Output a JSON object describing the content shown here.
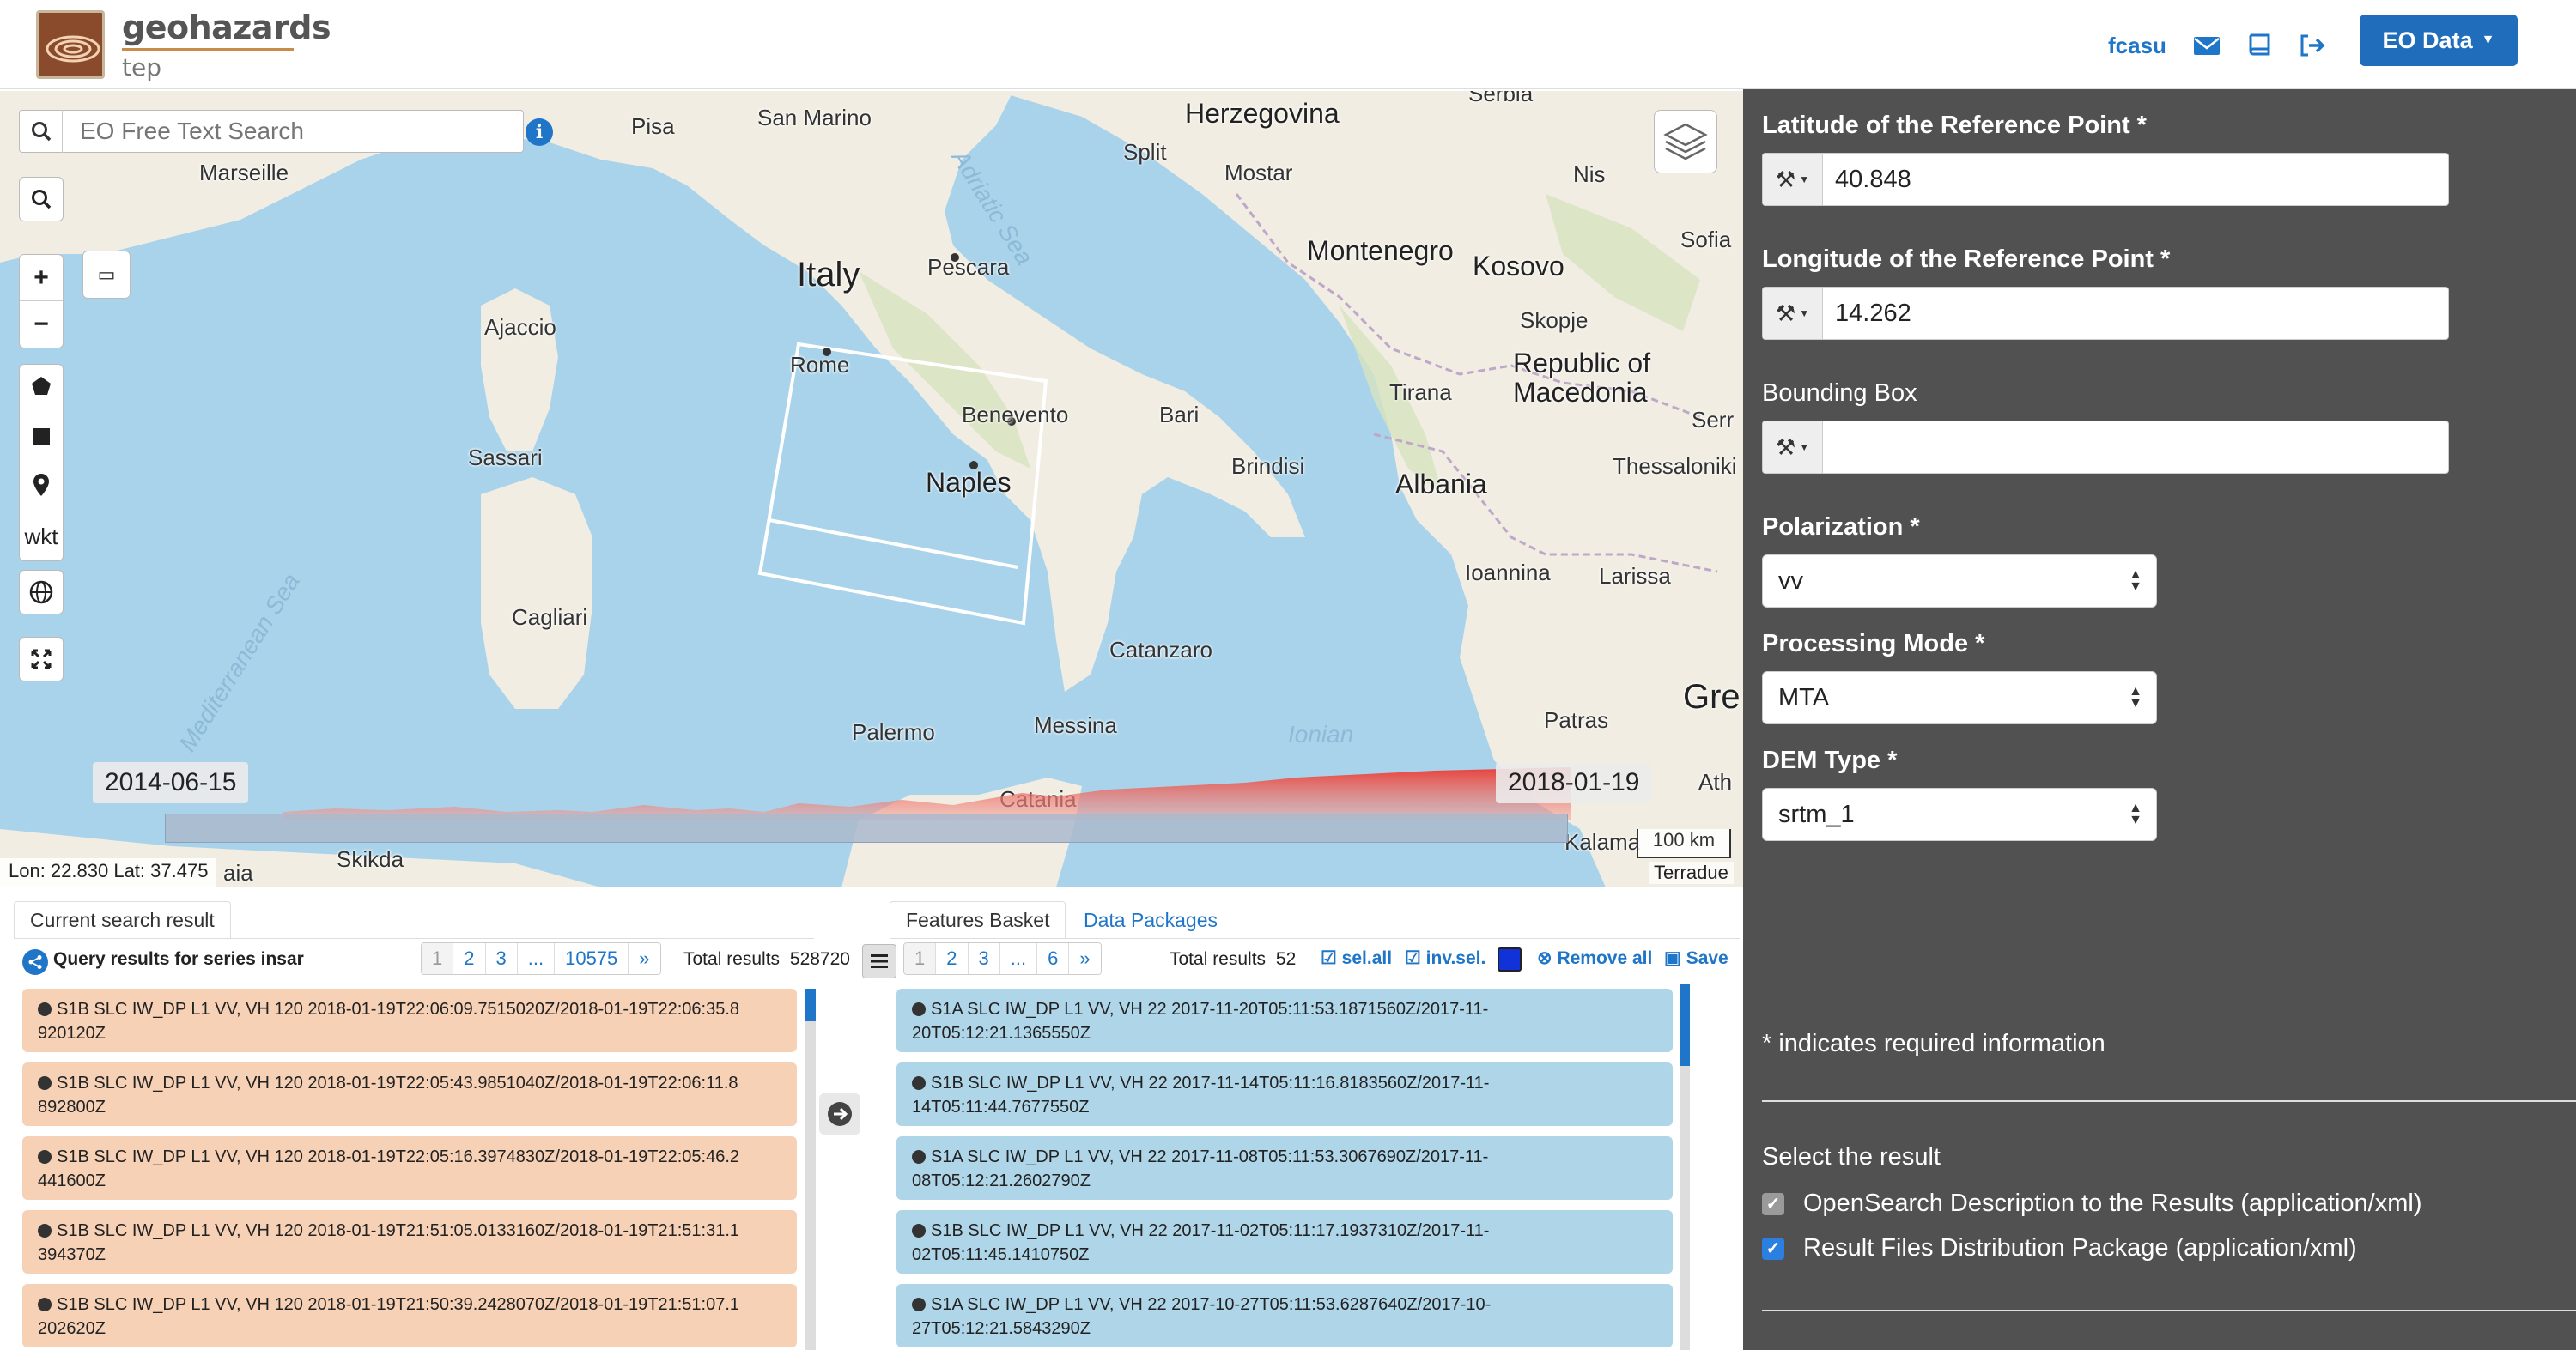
{
  "header": {
    "brand_name": "geohazards",
    "brand_sub": "tep",
    "user": "fcasu",
    "eo_data_label": "EO Data"
  },
  "map": {
    "search_placeholder": "EO Free Text Search",
    "ruler_glyph": "▭",
    "wkt_label": "wkt",
    "coords": "Lon: 22.830 Lat: 37.475",
    "scale": "100 km",
    "attribution": "Terradue",
    "timeline_start": "2014-06-15",
    "timeline_end": "2018-01-19",
    "places": {
      "herzegovina": "Herzegovina",
      "italy": "Italy",
      "albania": "Albania",
      "san_marino": "San Marino",
      "pisa": "Pisa",
      "marseille": "Marseille",
      "ajaccio": "Ajaccio",
      "sassari": "Sassari",
      "cagliari": "Cagliari",
      "rome": "Rome",
      "naples": "Naples",
      "benevento": "Benevento",
      "pescara": "Pescara",
      "split": "Split",
      "mostar": "Mostar",
      "nis": "Nis",
      "montenegro": "Montenegro",
      "kosovo": "Kosovo",
      "sofia": "Sofia",
      "skopje": "Skopje",
      "republic_of_macedonia": "Republic of\nMacedonia",
      "tirana": "Tirana",
      "bari": "Bari",
      "brindisi": "Brindisi",
      "thessaloniki": "Thessaloniki",
      "serr": "Serr",
      "ioannina": "Ioannina",
      "larissa": "Larissa",
      "catanzaro": "Catanzaro",
      "palermo": "Palermo",
      "messina": "Messina",
      "catania": "Catania",
      "patras": "Patras",
      "gre": "Gre",
      "ath": "Ath",
      "kalama": "Kalama",
      "skikda": "Skikda",
      "aia": "aia",
      "serbia": "Serbia",
      "adriatic_sea": "Adriatic Sea",
      "mediterranean_sea": "Mediterranean Sea",
      "ionian": "Ionian"
    }
  },
  "search_results": {
    "tab_label": "Current search result",
    "query_label": "Query results for series insar",
    "pages": [
      "1",
      "2",
      "3",
      "...",
      "10575",
      "»"
    ],
    "total_label": "Total results",
    "total_value": "528720",
    "items": [
      {
        "line1": "S1B SLC IW_DP L1 VV, VH 120 2018-01-19T22:06:09.7515020Z/2018-01-19T22:06:35.8",
        "line2": "920120Z"
      },
      {
        "line1": "S1B SLC IW_DP L1 VV, VH 120 2018-01-19T22:05:43.9851040Z/2018-01-19T22:06:11.8",
        "line2": "892800Z"
      },
      {
        "line1": "S1B SLC IW_DP L1 VV, VH 120 2018-01-19T22:05:16.3974830Z/2018-01-19T22:05:46.2",
        "line2": "441600Z"
      },
      {
        "line1": "S1B SLC IW_DP L1 VV, VH 120 2018-01-19T21:51:05.0133160Z/2018-01-19T21:51:31.1",
        "line2": "394370Z"
      },
      {
        "line1": "S1B SLC IW_DP L1 VV, VH 120 2018-01-19T21:50:39.2428070Z/2018-01-19T21:51:07.1",
        "line2": "202620Z"
      }
    ]
  },
  "basket": {
    "tab_label": "Features Basket",
    "tab2_label": "Data Packages",
    "pages": [
      "1",
      "2",
      "3",
      "...",
      "6",
      "»"
    ],
    "total_label": "Total results",
    "total_value": "52",
    "sel_all": "sel.all",
    "inv_sel": "inv.sel.",
    "remove_all": "Remove all",
    "save": "Save",
    "items": [
      {
        "line1": "S1A SLC IW_DP L1 VV, VH 22 2017-11-20T05:11:53.1871560Z/2017-11-",
        "line2": "20T05:12:21.1365550Z"
      },
      {
        "line1": "S1B SLC IW_DP L1 VV, VH 22 2017-11-14T05:11:16.8183560Z/2017-11-",
        "line2": "14T05:11:44.7677550Z"
      },
      {
        "line1": "S1A SLC IW_DP L1 VV, VH 22 2017-11-08T05:11:53.3067690Z/2017-11-",
        "line2": "08T05:12:21.2602790Z"
      },
      {
        "line1": "S1B SLC IW_DP L1 VV, VH 22 2017-11-02T05:11:17.1937310Z/2017-11-",
        "line2": "02T05:11:45.1410750Z"
      },
      {
        "line1": "S1A SLC IW_DP L1 VV, VH 22 2017-10-27T05:11:53.6287640Z/2017-10-",
        "line2": "27T05:12:21.5843290Z"
      }
    ]
  },
  "form": {
    "lat_label": "Latitude of the Reference Point *",
    "lat_value": "40.848",
    "lon_label": "Longitude of the Reference Point *",
    "lon_value": "14.262",
    "bbox_label": "Bounding Box",
    "bbox_value": "",
    "polarization_label": "Polarization *",
    "polarization_value": "vv",
    "processing_label": "Processing Mode *",
    "processing_value": "MTA",
    "dem_label": "DEM Type *",
    "dem_value": "srtm_1",
    "required_note": "* indicates required information",
    "select_result_label": "Select the result",
    "opt1_label": "OpenSearch Description to the Results (application/xml)",
    "opt1_checked": true,
    "opt2_label": "Result Files Distribution Package (application/xml)",
    "opt2_checked": true
  },
  "colors": {
    "accent": "#1f76c8",
    "form_bg": "#515151",
    "result_item": "#f7d1b5",
    "basket_item": "#afd5e8",
    "histogram": "#e8403a"
  }
}
